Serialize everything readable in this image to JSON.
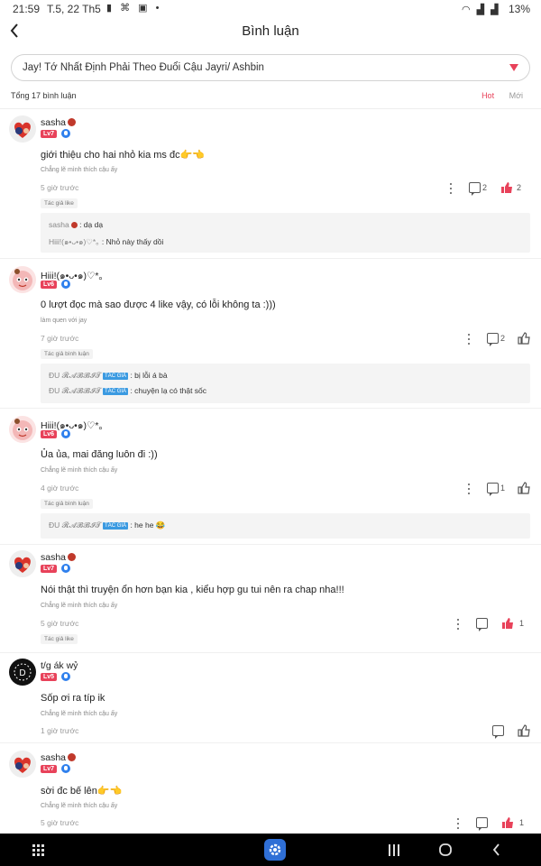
{
  "status": {
    "time": "21:59",
    "date": "T.5, 22 Th5",
    "battery": "13%"
  },
  "header": {
    "title": "Bình luận"
  },
  "story": {
    "selected": "Jay! Tớ Nhất Định Phải Theo Đuổi Cậu Jayri/ Ashbin"
  },
  "summary": {
    "total": "Tổng 17 bình luận",
    "sort_hot": "Hot",
    "sort_new": "Mới"
  },
  "colors": {
    "accent": "#e8425a",
    "level_badge": "#e8425a",
    "verified": "#2f80ed",
    "navbar": "#000000"
  },
  "comments": [
    {
      "user": "sasha",
      "level": "Lv7",
      "text": "giới thiệu cho hai nhỏ kia ms đc👉👈",
      "sub": "Chẳng lẽ mình thích cậu ấy",
      "time": "5 giờ trước",
      "replies": "2",
      "likes": "2",
      "author_tag": "Tác giả like"
    },
    {
      "user": "Hiii!(๑•ᴗ•๑)♡*｡",
      "level": "Lv6",
      "text": "0 lượt đọc mà sao được 4 like vậy, có lỗi không ta :)))",
      "sub": "làm quen với jay",
      "time": "7 giờ trước",
      "replies": "2",
      "author_tag": "Tác giả bình luận"
    },
    {
      "user": "Hiii!(๑•ᴗ•๑)♡*｡",
      "level": "Lv6",
      "text": "Ủa ủa, mai đăng luôn đi :))",
      "sub": "Chẳng lẽ mình thích cậu ấy",
      "time": "4 giờ trước",
      "replies": "1",
      "author_tag": "Tác giả bình luận"
    },
    {
      "user": "sasha",
      "level": "Lv7",
      "text": "Nói thật thì truyện ổn hơn bạn kia , kiểu hợp gu tui  nên ra chap  nha!!!",
      "sub": "Chẳng lẽ mình thích cậu ấy",
      "time": "5 giờ trước",
      "likes": "1",
      "author_tag": "Tác giả like"
    },
    {
      "user": "t/g ák wỷ",
      "level": "Lv5",
      "text": "Sốp ơi ra típ ik",
      "sub": "Chẳng lẽ mình thích cậu ấy",
      "time": "1 giờ trước"
    },
    {
      "user": "sasha",
      "level": "Lv7",
      "text": "sời đc bế lên👉👈",
      "sub": "Chẳng lẽ mình thích cậu ấy",
      "time": "5 giờ trước",
      "likes": "1"
    }
  ],
  "reply_threads": [
    [
      {
        "name": "sasha",
        "text": ": dạ dạ"
      },
      {
        "name": "Hiii!(๑•ᴗ•๑)♡*｡",
        "text": ": Nhỏ này thấy dồi"
      }
    ],
    [
      {
        "name": "ĐU 𝓡𝓐𝓑𝓑𝓘𝓣",
        "tag": "TÁC GIẢ",
        "text": ": bị lỗi á bà"
      },
      {
        "name": "ĐU 𝓡𝓐𝓑𝓑𝓘𝓣",
        "tag": "TÁC GIẢ",
        "text": ": chuyện lạ có thật sốc"
      }
    ],
    [
      {
        "name": "ĐU 𝓡𝓐𝓑𝓑𝓘𝓣",
        "tag": "TÁC GIẢ",
        "text": ": he he 😂"
      }
    ]
  ]
}
